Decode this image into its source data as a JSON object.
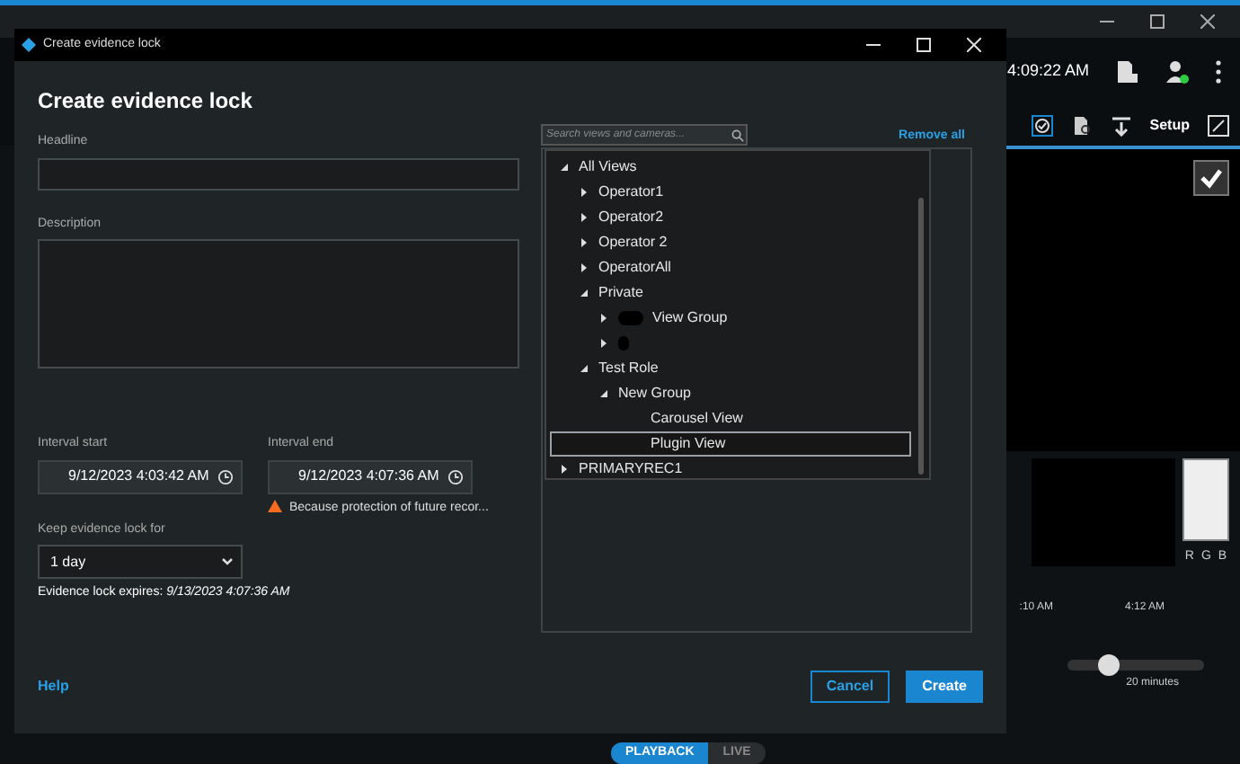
{
  "app": {
    "clock": "4:09:22 AM",
    "setup_button": "Setup",
    "color_channels": [
      "R",
      "G",
      "B"
    ],
    "timeline_ticks": [
      ":10 AM",
      "4:12 AM"
    ],
    "zoom_slider": {
      "level": 0.3,
      "reading": "20 minutes"
    },
    "mode_toggle": [
      {
        "label": "PLAYBACK",
        "selected": true
      },
      {
        "label": "LIVE",
        "selected": false
      }
    ]
  },
  "dialog": {
    "window_title": "Create evidence lock",
    "heading": "Create evidence lock",
    "headline": {
      "label": "Headline"
    },
    "description": {
      "label": "Description"
    },
    "interval_start": {
      "label": "Interval start",
      "value": "9/12/2023 4:03:42 AM"
    },
    "interval_end": {
      "label": "Interval end",
      "value": "9/12/2023 4:07:36 AM"
    },
    "warning": "Because protection of future recor...",
    "keep_for": {
      "label": "Keep evidence lock for",
      "value": "1 day"
    },
    "expires": {
      "label": "Evidence lock expires:",
      "value": "9/13/2023 4:07:36 AM"
    },
    "search": {
      "placeholder": "Search views and cameras..."
    },
    "remove_all": "Remove all",
    "tree": [
      {
        "label": "All Views",
        "expanded": true,
        "selected": false,
        "children": [
          {
            "label": "Operator1",
            "expanded": false,
            "selected": false
          },
          {
            "label": "Operator2",
            "expanded": false,
            "selected": false
          },
          {
            "label": "Operator 2",
            "expanded": false,
            "selected": false
          },
          {
            "label": "OperatorAll",
            "expanded": false,
            "selected": false
          },
          {
            "label": "Private",
            "expanded": true,
            "selected": false,
            "children": [
              {
                "label": "View Group",
                "redacted": true,
                "expanded": false,
                "selected": false
              },
              {
                "redacted": true,
                "expanded": false,
                "selected": false
              }
            ]
          },
          {
            "label": "Test Role",
            "expanded": true,
            "selected": false,
            "children": [
              {
                "label": "New Group",
                "expanded": true,
                "selected": false,
                "children": [
                  {
                    "label": "Carousel View",
                    "leaf": true,
                    "selected": false
                  },
                  {
                    "label": "Plugin View",
                    "leaf": true,
                    "selected": true
                  }
                ]
              }
            ]
          }
        ]
      },
      {
        "label": "PRIMARYREC1",
        "expanded": false,
        "selected": false
      }
    ],
    "help": "Help",
    "cancel": "Cancel",
    "create": "Create"
  }
}
